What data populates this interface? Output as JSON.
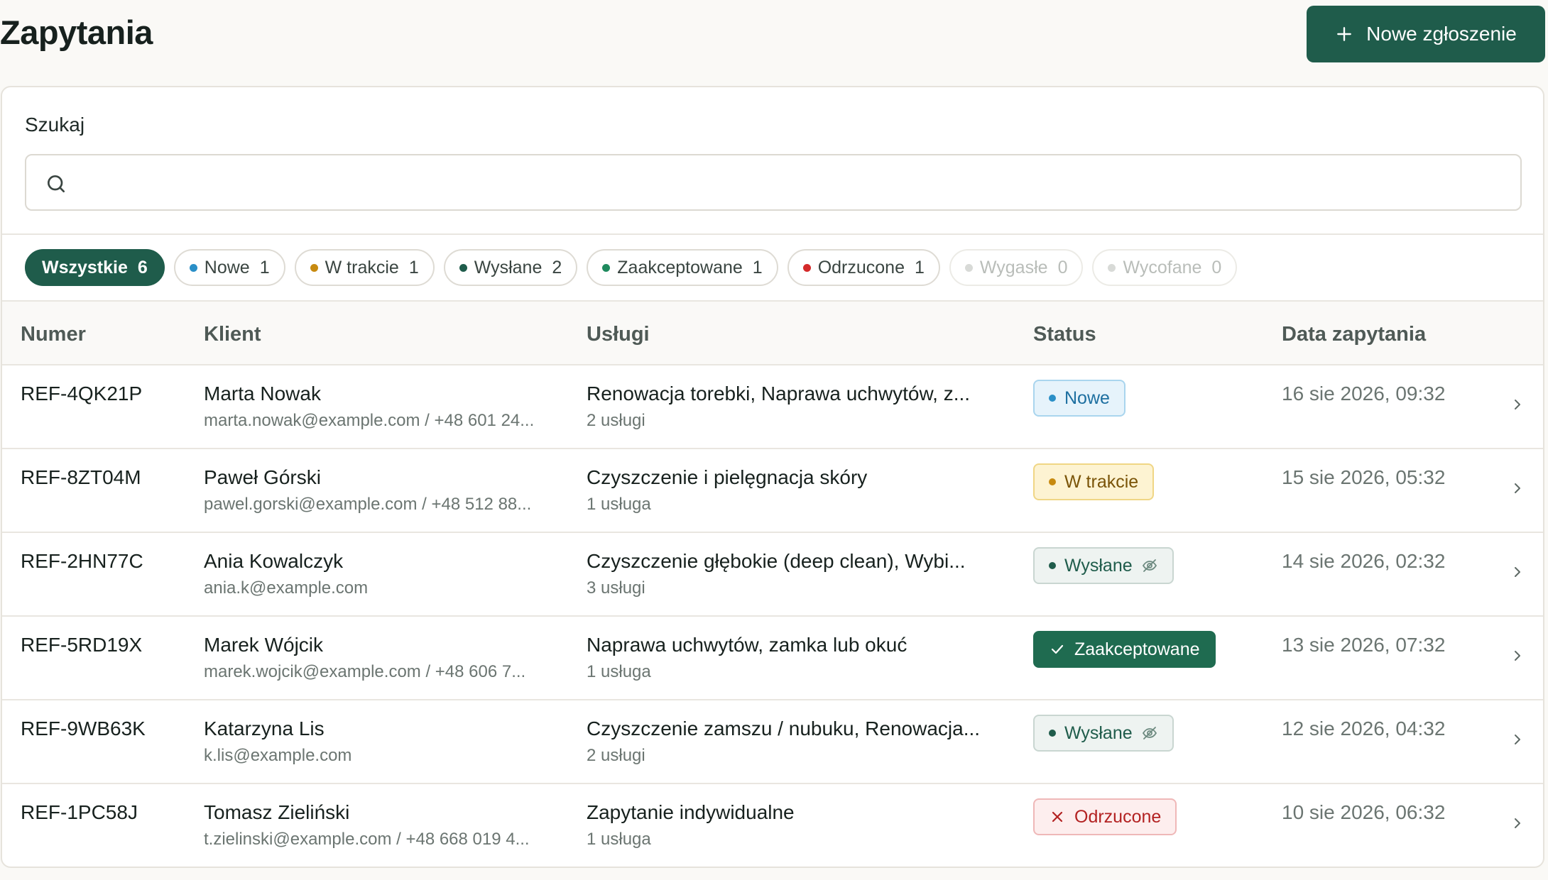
{
  "header": {
    "title": "Zapytania",
    "new_button_label": "Nowe zgłoszenie"
  },
  "search": {
    "label": "Szukaj",
    "value": "",
    "placeholder": ""
  },
  "filters": [
    {
      "label": "Wszystkie",
      "count": "6",
      "active": true,
      "color": ""
    },
    {
      "label": "Nowe",
      "count": "1",
      "color": "#2a8fc7"
    },
    {
      "label": "W trakcie",
      "count": "1",
      "color": "#c78a10"
    },
    {
      "label": "Wysłane",
      "count": "2",
      "color": "#1f5c4b"
    },
    {
      "label": "Zaakceptowane",
      "count": "1",
      "color": "#1f8a5e"
    },
    {
      "label": "Odrzucone",
      "count": "1",
      "color": "#d42a2a"
    },
    {
      "label": "Wygasłe",
      "count": "0",
      "color": "#d8dad7",
      "muted": true
    },
    {
      "label": "Wycofane",
      "count": "0",
      "color": "#d8dad7",
      "muted": true
    }
  ],
  "table": {
    "columns": [
      "Numer",
      "Klient",
      "Usługi",
      "Status",
      "Data zapytania"
    ],
    "rows": [
      {
        "number": "REF-4QK21P",
        "client": "Marta Nowak",
        "contact": "marta.nowak@example.com / +48 601 24...",
        "services": "Renowacja torebki, Naprawa uchwytów, z...",
        "service_count": "2 usługi",
        "status": "Nowe",
        "status_kind": "nowe",
        "date": "16 sie 2026, 09:32"
      },
      {
        "number": "REF-8ZT04M",
        "client": "Paweł Górski",
        "contact": "pawel.gorski@example.com / +48 512 88...",
        "services": "Czyszczenie i pielęgnacja skóry",
        "service_count": "1 usługa",
        "status": "W trakcie",
        "status_kind": "trakcie",
        "date": "15 sie 2026, 05:32"
      },
      {
        "number": "REF-2HN77C",
        "client": "Ania Kowalczyk",
        "contact": "ania.k@example.com",
        "services": "Czyszczenie głębokie (deep clean), Wybi...",
        "service_count": "3 usługi",
        "status": "Wysłane",
        "status_kind": "wyslane",
        "date": "14 sie 2026, 02:32"
      },
      {
        "number": "REF-5RD19X",
        "client": "Marek Wójcik",
        "contact": "marek.wojcik@example.com / +48 606 7...",
        "services": "Naprawa uchwytów, zamka lub okuć",
        "service_count": "1 usługa",
        "status": "Zaakceptowane",
        "status_kind": "zaak",
        "date": "13 sie 2026, 07:32"
      },
      {
        "number": "REF-9WB63K",
        "client": "Katarzyna Lis",
        "contact": "k.lis@example.com",
        "services": "Czyszczenie zamszu / nubuku, Renowacja...",
        "service_count": "2 usługi",
        "status": "Wysłane",
        "status_kind": "wyslane",
        "date": "12 sie 2026, 04:32"
      },
      {
        "number": "REF-1PC58J",
        "client": "Tomasz Zieliński",
        "contact": "t.zielinski@example.com / +48 668 019 4...",
        "services": "Zapytanie indywidualne",
        "service_count": "1 usługa",
        "status": "Odrzucone",
        "status_kind": "odrz",
        "date": "10 sie 2026, 06:32"
      }
    ]
  },
  "icons": {
    "new_button": "plus-icon",
    "search": "search-icon",
    "row_action": "chevron-right-icon",
    "hidden": "eye-off-icon",
    "accepted": "check-icon",
    "rejected": "x-icon"
  }
}
